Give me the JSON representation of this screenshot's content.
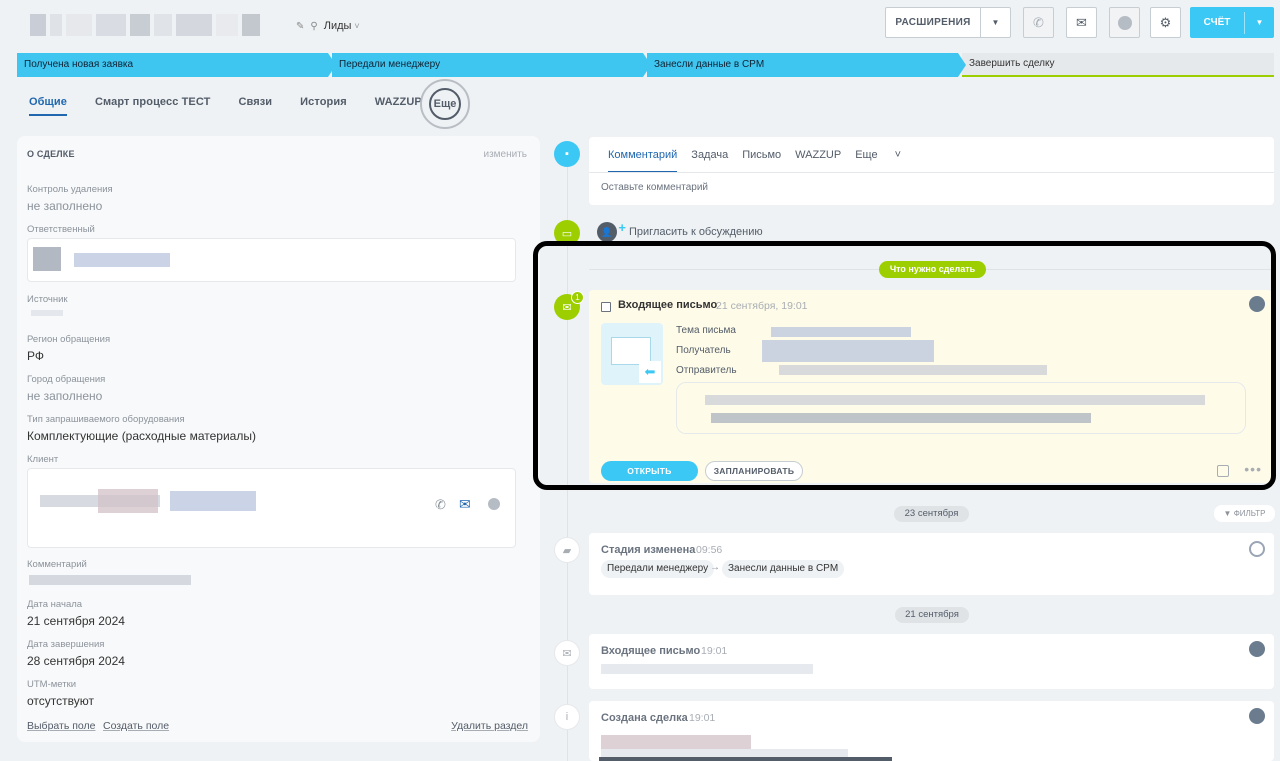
{
  "header": {
    "pipeline": "Лиды",
    "extensions_label": "РАСШИРЕНИЯ",
    "invoice_label": "СЧЁТ"
  },
  "stages": [
    {
      "label": "Получена новая заявка",
      "status": "done"
    },
    {
      "label": "Передали менеджеру",
      "status": "done"
    },
    {
      "label": "Занесли данные в CPM",
      "status": "done"
    },
    {
      "label": "Завершить сделку",
      "status": "todo"
    }
  ],
  "tabs": [
    {
      "label": "Общие",
      "active": true
    },
    {
      "label": "Смарт процесс ТЕСТ"
    },
    {
      "label": "Связи"
    },
    {
      "label": "История"
    },
    {
      "label": "WAZZUP"
    },
    {
      "label": "Еще"
    }
  ],
  "deal": {
    "section_title": "О СДЕЛКЕ",
    "edit_label": "изменить",
    "fields": {
      "deletion_control": {
        "label": "Контроль удаления",
        "value": "не заполнено"
      },
      "responsible": {
        "label": "Ответственный"
      },
      "source": {
        "label": "Источник"
      },
      "region": {
        "label": "Регион обращения",
        "value": "РФ"
      },
      "city": {
        "label": "Город обращения",
        "value": "не заполнено"
      },
      "equipment": {
        "label": "Тип запрашиваемого оборудования",
        "value": "Комплектующие (расходные материалы)"
      },
      "client": {
        "label": "Клиент"
      },
      "comment": {
        "label": "Комментарий"
      },
      "start_date": {
        "label": "Дата начала",
        "value": "21 сентября 2024"
      },
      "end_date": {
        "label": "Дата завершения",
        "value": "28 сентября 2024"
      },
      "utm": {
        "label": "UTM-метки",
        "value": "отсутствуют"
      }
    },
    "footer": {
      "choose_field": "Выбрать поле",
      "create_field": "Создать поле",
      "delete_section": "Удалить раздел"
    }
  },
  "editor": {
    "tabs": [
      "Комментарий",
      "Задача",
      "Письмо",
      "WAZZUP",
      "Еще"
    ],
    "placeholder": "Оставьте комментарий"
  },
  "timeline": {
    "invite_label": "Пригласить к обсуждению",
    "todo_label": "Что нужно сделать",
    "todo_count": "1",
    "mail_activity": {
      "title": "Входящее письмо",
      "time": "21 сентября, 19:01",
      "subject_label": "Тема письма",
      "recipient_label": "Получатель",
      "sender_label": "Отправитель",
      "open_label": "ОТКРЫТЬ",
      "plan_label": "ЗАПЛАНИРОВАТЬ"
    },
    "filter_label": "ФИЛЬТР",
    "groups": [
      {
        "date": "23 сентября",
        "items": [
          {
            "title": "Стадия изменена",
            "time": "09:56",
            "from": "Передали менеджеру",
            "to": "Занесли данные в CPM"
          }
        ]
      },
      {
        "date": "21 сентября",
        "items": [
          {
            "title": "Входящее письмо",
            "time": "19:01"
          },
          {
            "title": "Создана сделка",
            "time": "19:01"
          }
        ]
      }
    ]
  },
  "colors": {
    "accent": "#3bc8f5",
    "link": "#2067b0",
    "green": "#9dcf00",
    "background": "#eef2f4"
  }
}
